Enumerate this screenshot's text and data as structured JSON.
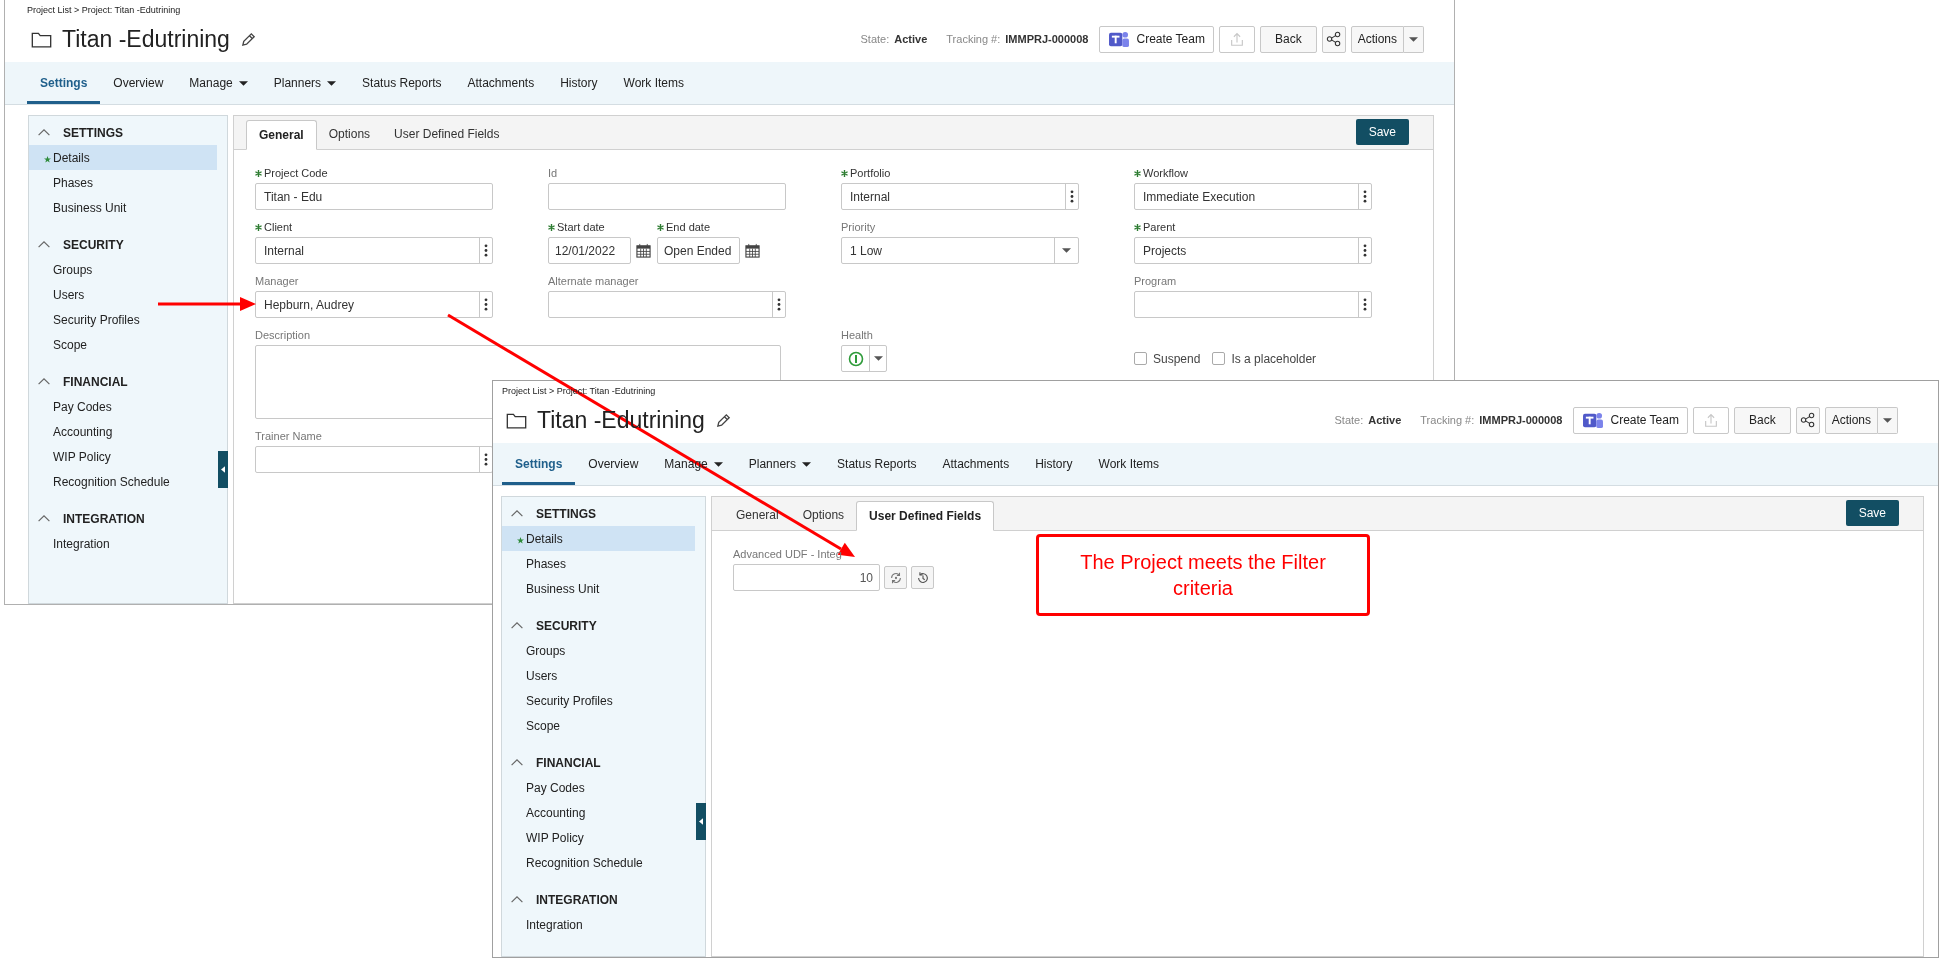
{
  "windows": [
    {
      "breadcrumb": "Project List > Project: Titan -Edutrining",
      "title": "Titan -Edutrining",
      "state_label": "State:",
      "state": "Active",
      "tracking_label": "Tracking #:",
      "tracking": "IMMPRJ-000008",
      "header_buttons": [
        {
          "kind": "teams",
          "label": "Create Team"
        },
        {
          "kind": "upload",
          "disabled": true
        },
        {
          "kind": "text",
          "label": "Back"
        },
        {
          "kind": "share"
        },
        {
          "kind": "dropdown",
          "label": "Actions"
        }
      ],
      "nav": [
        {
          "label": "Settings",
          "selected": true,
          "menu": false
        },
        {
          "label": "Overview",
          "selected": false,
          "menu": false
        },
        {
          "label": "Manage",
          "selected": false,
          "menu": true
        },
        {
          "label": "Planners",
          "selected": false,
          "menu": true
        },
        {
          "label": "Status Reports",
          "selected": false,
          "menu": false
        },
        {
          "label": "Attachments",
          "selected": false,
          "menu": false
        },
        {
          "label": "History",
          "selected": false,
          "menu": false
        },
        {
          "label": "Work Items",
          "selected": false,
          "menu": false
        }
      ],
      "sidebar": [
        {
          "title": "SETTINGS",
          "expanded": true,
          "items": [
            {
              "label": "Details",
              "selected": true,
              "starred": true
            },
            {
              "label": "Phases",
              "selected": false,
              "starred": false
            },
            {
              "label": "Business Unit",
              "selected": false,
              "starred": false
            }
          ]
        },
        {
          "title": "SECURITY",
          "expanded": true,
          "items": [
            {
              "label": "Groups",
              "selected": false,
              "starred": false
            },
            {
              "label": "Users",
              "selected": false,
              "starred": false
            },
            {
              "label": "Security Profiles",
              "selected": false,
              "starred": false
            },
            {
              "label": "Scope",
              "selected": false,
              "starred": false
            }
          ]
        },
        {
          "title": "FINANCIAL",
          "expanded": true,
          "items": [
            {
              "label": "Pay Codes",
              "selected": false,
              "starred": false
            },
            {
              "label": "Accounting",
              "selected": false,
              "starred": false
            },
            {
              "label": "WIP Policy",
              "selected": false,
              "starred": false
            },
            {
              "label": "Recognition Schedule",
              "selected": false,
              "starred": false
            }
          ]
        },
        {
          "title": "INTEGRATION",
          "expanded": true,
          "items": [
            {
              "label": "Integration",
              "selected": false,
              "starred": false
            }
          ]
        }
      ],
      "panel_tabs": [
        {
          "label": "General",
          "selected": true
        },
        {
          "label": "Options",
          "selected": false
        },
        {
          "label": "User Defined Fields",
          "selected": false
        }
      ],
      "save": "Save",
      "form_rows": [
        [
          {
            "kind": "text",
            "label": "Project Code",
            "required": true,
            "value": "Titan - Edu"
          },
          {
            "kind": "text",
            "label": "Id",
            "required": false
          },
          {
            "kind": "menu",
            "label": "Portfolio",
            "required": true,
            "value": "Internal"
          },
          {
            "kind": "menu",
            "label": "Workflow",
            "required": true,
            "value": "Immediate Execution"
          }
        ],
        [
          {
            "kind": "menu",
            "label": "Client",
            "required": true,
            "value": "Internal"
          },
          {
            "kind": "daterange",
            "parts": [
              {
                "label": "Start date",
                "required": true,
                "value": "12/01/2022"
              },
              {
                "label": "End date",
                "required": true,
                "value": "Open Ended"
              }
            ]
          },
          {
            "kind": "select",
            "label": "Priority",
            "required": false,
            "value": "1 Low"
          },
          {
            "kind": "menu",
            "label": "Parent",
            "required": true,
            "value": "Projects"
          }
        ],
        [
          {
            "kind": "menu",
            "label": "Manager",
            "required": false,
            "value": "Hepburn, Audrey"
          },
          {
            "kind": "menu",
            "label": "Alternate manager",
            "required": false
          },
          {
            "kind": "spacer"
          },
          {
            "kind": "menu",
            "label": "Program",
            "required": false
          }
        ],
        [
          {
            "kind": "textarea",
            "label": "Description",
            "required": false
          },
          {
            "kind": "health",
            "label": "Health"
          },
          {
            "kind": "checks",
            "boxes": [
              {
                "label": "Suspend",
                "checked": false
              },
              {
                "label": "Is a placeholder",
                "checked": false
              }
            ]
          }
        ],
        [
          {
            "kind": "menu",
            "label": "Trainer Name",
            "required": false
          }
        ]
      ]
    },
    {
      "breadcrumb": "Project List > Project: Titan -Edutrining",
      "title": "Titan -Edutrining",
      "state_label": "State:",
      "state": "Active",
      "tracking_label": "Tracking #:",
      "tracking": "IMMPRJ-000008",
      "header_buttons": [
        {
          "kind": "teams",
          "label": "Create Team"
        },
        {
          "kind": "upload",
          "disabled": true
        },
        {
          "kind": "text",
          "label": "Back"
        },
        {
          "kind": "share"
        },
        {
          "kind": "dropdown",
          "label": "Actions"
        }
      ],
      "nav": [
        {
          "label": "Settings",
          "selected": true,
          "menu": false
        },
        {
          "label": "Overview",
          "selected": false,
          "menu": false
        },
        {
          "label": "Manage",
          "selected": false,
          "menu": true
        },
        {
          "label": "Planners",
          "selected": false,
          "menu": true
        },
        {
          "label": "Status Reports",
          "selected": false,
          "menu": false
        },
        {
          "label": "Attachments",
          "selected": false,
          "menu": false
        },
        {
          "label": "History",
          "selected": false,
          "menu": false
        },
        {
          "label": "Work Items",
          "selected": false,
          "menu": false
        }
      ],
      "sidebar": [
        {
          "title": "SETTINGS",
          "expanded": true,
          "items": [
            {
              "label": "Details",
              "selected": true,
              "starred": true
            },
            {
              "label": "Phases",
              "selected": false,
              "starred": false
            },
            {
              "label": "Business Unit",
              "selected": false,
              "starred": false
            }
          ]
        },
        {
          "title": "SECURITY",
          "expanded": true,
          "items": [
            {
              "label": "Groups",
              "selected": false,
              "starred": false
            },
            {
              "label": "Users",
              "selected": false,
              "starred": false
            },
            {
              "label": "Security Profiles",
              "selected": false,
              "starred": false
            },
            {
              "label": "Scope",
              "selected": false,
              "starred": false
            }
          ]
        },
        {
          "title": "FINANCIAL",
          "expanded": true,
          "items": [
            {
              "label": "Pay Codes",
              "selected": false,
              "starred": false
            },
            {
              "label": "Accounting",
              "selected": false,
              "starred": false
            },
            {
              "label": "WIP Policy",
              "selected": false,
              "starred": false
            },
            {
              "label": "Recognition Schedule",
              "selected": false,
              "starred": false
            }
          ]
        },
        {
          "title": "INTEGRATION",
          "expanded": true,
          "items": [
            {
              "label": "Integration",
              "selected": false,
              "starred": false
            }
          ]
        }
      ],
      "panel_tabs": [
        {
          "label": "General",
          "selected": false
        },
        {
          "label": "Options",
          "selected": false
        },
        {
          "label": "User Defined Fields",
          "selected": true
        }
      ],
      "save": "Save",
      "form_rows": [
        [
          {
            "kind": "udf",
            "label": "Advanced UDF - Integ",
            "required": false,
            "value": "10"
          }
        ]
      ]
    }
  ],
  "callout": {
    "text": "The Project meets the Filter criteria"
  }
}
